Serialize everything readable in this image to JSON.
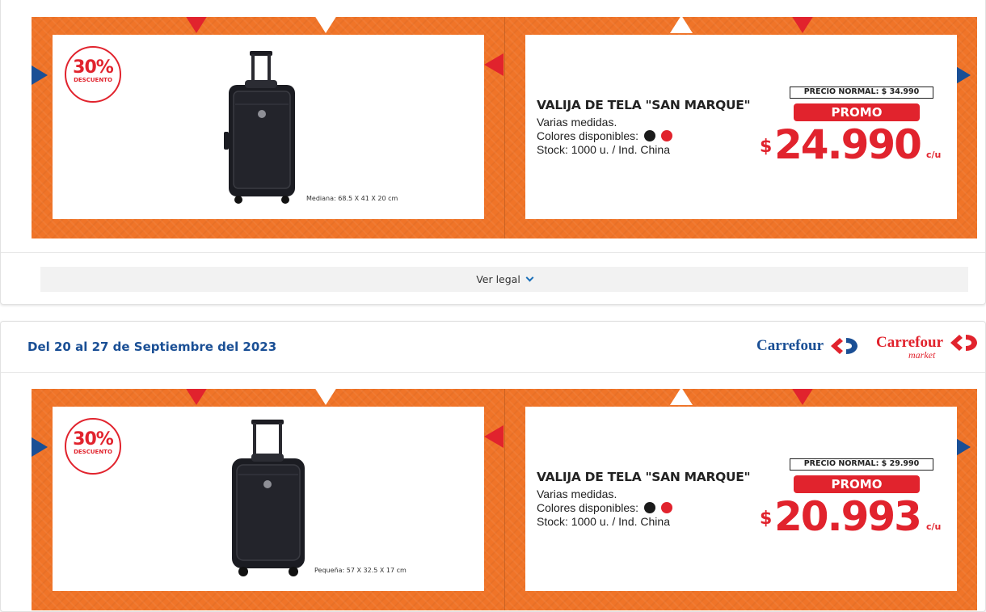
{
  "offers": [
    {
      "discount": {
        "percent": "30%",
        "label": "DESCUENTO"
      },
      "dimensions": "Mediana: 68.5 X 41 X 20 cm",
      "title": "VALIJA DE TELA \"SAN MARQUE\"",
      "desc_line1": "Varias medidas.",
      "desc_line2": "Colores disponibles:",
      "desc_line3": "Stock: 1000 u. / Ind. China",
      "normal_price": "PRECIO NORMAL: $ 34.990",
      "promo_label": "PROMO",
      "currency": "$",
      "price": "24.990",
      "unit": "c/u",
      "colors": [
        "#1b1b1b",
        "#e1232d"
      ]
    },
    {
      "discount": {
        "percent": "30%",
        "label": "DESCUENTO"
      },
      "dimensions": "Pequeña: 57 X 32.5 X 17 cm",
      "title": "VALIJA DE TELA \"SAN MARQUE\"",
      "desc_line1": "Varias medidas.",
      "desc_line2": "Colores disponibles:",
      "desc_line3": "Stock: 1000 u. / Ind. China",
      "normal_price": "PRECIO NORMAL: $ 29.990",
      "promo_label": "PROMO",
      "currency": "$",
      "price": "20.993",
      "unit": "c/u",
      "colors": [
        "#1b1b1b",
        "#e1232d"
      ]
    }
  ],
  "legal": {
    "label": "Ver legal"
  },
  "second_card": {
    "date_range": "Del 20 al 27 de Septiembre del 2023",
    "logos": {
      "carrefour": "Carrefour",
      "carrefour_market": "Carrefour",
      "market_sub": "market"
    }
  },
  "colors": {
    "brand_blue": "#1a4f95",
    "brand_red": "#e1232d",
    "banner_orange": "#f07428"
  }
}
